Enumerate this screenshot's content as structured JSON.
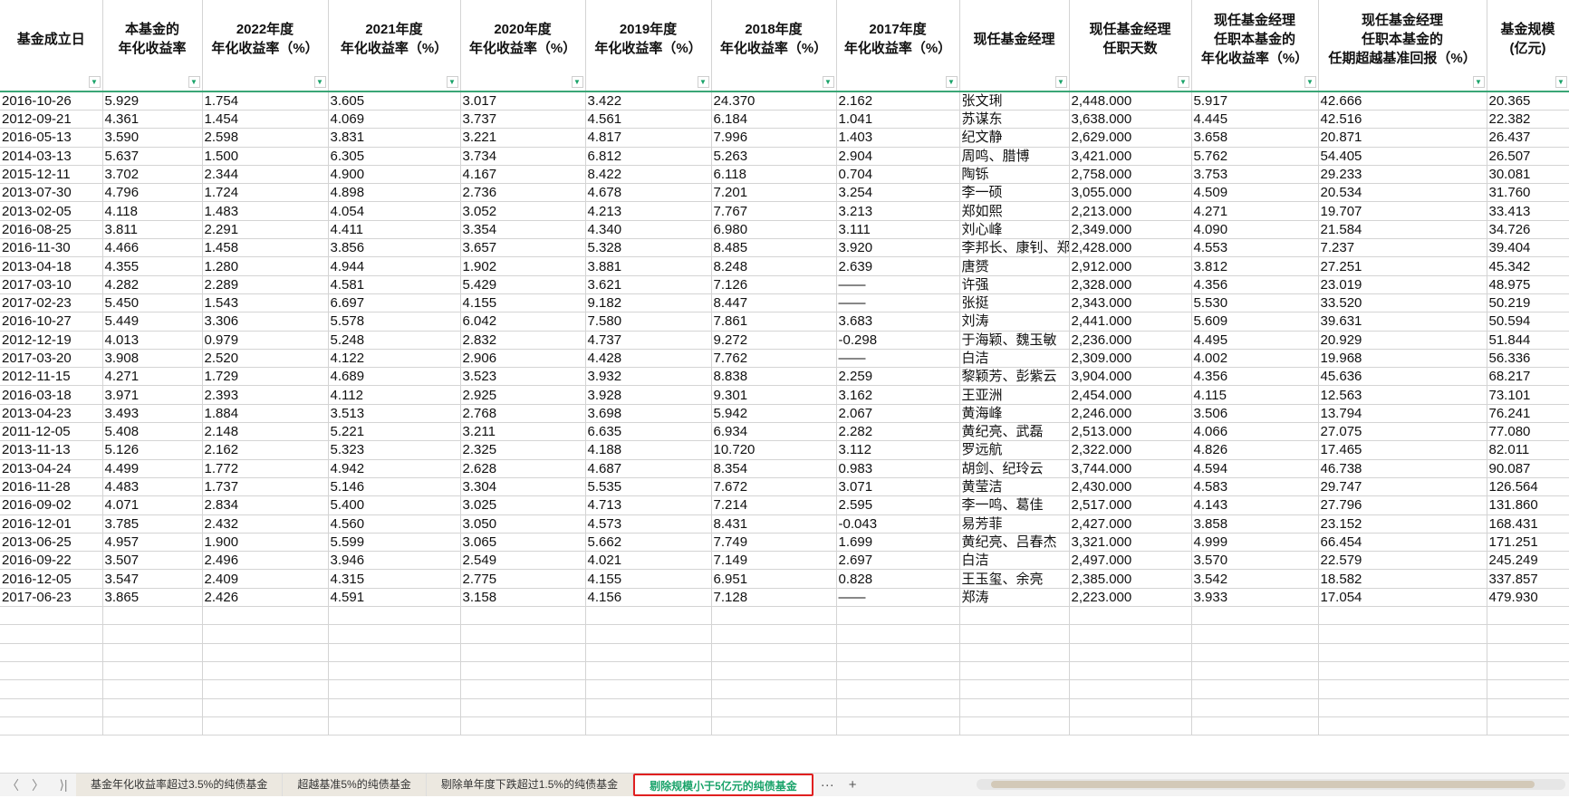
{
  "columns": [
    "基金成立日",
    "本基金的\n年化收益率",
    "2022年度\n年化收益率（%）",
    "2021年度\n年化收益率（%）",
    "2020年度\n年化收益率（%）",
    "2019年度\n年化收益率（%）",
    "2018年度\n年化收益率（%）",
    "2017年度\n年化收益率（%）",
    "现任基金经理",
    "现任基金经理\n任职天数",
    "现任基金经理\n任职本基金的\n年化收益率（%）",
    "现任基金经理\n任职本基金的\n任期超越基准回报（%）",
    "基金规模\n(亿元)"
  ],
  "rows": [
    [
      "2016-10-26",
      "5.929",
      "1.754",
      "3.605",
      "3.017",
      "3.422",
      "24.370",
      "2.162",
      "张文琍",
      "2,448.000",
      "5.917",
      "42.666",
      "20.365"
    ],
    [
      "2012-09-21",
      "4.361",
      "1.454",
      "4.069",
      "3.737",
      "4.561",
      "6.184",
      "1.041",
      "苏谋东",
      "3,638.000",
      "4.445",
      "42.516",
      "22.382"
    ],
    [
      "2016-05-13",
      "3.590",
      "2.598",
      "3.831",
      "3.221",
      "4.817",
      "7.996",
      "1.403",
      "纪文静",
      "2,629.000",
      "3.658",
      "20.871",
      "26.437"
    ],
    [
      "2014-03-13",
      "5.637",
      "1.500",
      "6.305",
      "3.734",
      "6.812",
      "5.263",
      "2.904",
      "周鸣、腊博",
      "3,421.000",
      "5.762",
      "54.405",
      "26.507"
    ],
    [
      "2015-12-11",
      "3.702",
      "2.344",
      "4.900",
      "4.167",
      "8.422",
      "6.118",
      "0.704",
      "陶铄",
      "2,758.000",
      "3.753",
      "29.233",
      "30.081"
    ],
    [
      "2013-07-30",
      "4.796",
      "1.724",
      "4.898",
      "2.736",
      "4.678",
      "7.201",
      "3.254",
      "李一硕",
      "3,055.000",
      "4.509",
      "20.534",
      "31.760"
    ],
    [
      "2013-02-05",
      "4.118",
      "1.483",
      "4.054",
      "3.052",
      "4.213",
      "7.767",
      "3.213",
      "郑如熙",
      "2,213.000",
      "4.271",
      "19.707",
      "33.413"
    ],
    [
      "2016-08-25",
      "3.811",
      "2.291",
      "4.411",
      "3.354",
      "4.340",
      "6.980",
      "3.111",
      "刘心峰",
      "2,349.000",
      "4.090",
      "21.584",
      "34.726"
    ],
    [
      "2016-11-30",
      "4.466",
      "1.458",
      "3.856",
      "3.657",
      "5.328",
      "8.485",
      "3.920",
      "李邦长、康钊、郑",
      "2,428.000",
      "4.553",
      "7.237",
      "39.404"
    ],
    [
      "2013-04-18",
      "4.355",
      "1.280",
      "4.944",
      "1.902",
      "3.881",
      "8.248",
      "2.639",
      "唐赟",
      "2,912.000",
      "3.812",
      "27.251",
      "45.342"
    ],
    [
      "2017-03-10",
      "4.282",
      "2.289",
      "4.581",
      "5.429",
      "3.621",
      "7.126",
      "——",
      "许强",
      "2,328.000",
      "4.356",
      "23.019",
      "48.975"
    ],
    [
      "2017-02-23",
      "5.450",
      "1.543",
      "6.697",
      "4.155",
      "9.182",
      "8.447",
      "——",
      "张挺",
      "2,343.000",
      "5.530",
      "33.520",
      "50.219"
    ],
    [
      "2016-10-27",
      "5.449",
      "3.306",
      "5.578",
      "6.042",
      "7.580",
      "7.861",
      "3.683",
      "刘涛",
      "2,441.000",
      "5.609",
      "39.631",
      "50.594"
    ],
    [
      "2012-12-19",
      "4.013",
      "0.979",
      "5.248",
      "2.832",
      "4.737",
      "9.272",
      "-0.298",
      "于海颖、魏玉敏",
      "2,236.000",
      "4.495",
      "20.929",
      "51.844"
    ],
    [
      "2017-03-20",
      "3.908",
      "2.520",
      "4.122",
      "2.906",
      "4.428",
      "7.762",
      "——",
      "白洁",
      "2,309.000",
      "4.002",
      "19.968",
      "56.336"
    ],
    [
      "2012-11-15",
      "4.271",
      "1.729",
      "4.689",
      "3.523",
      "3.932",
      "8.838",
      "2.259",
      "黎颖芳、彭紫云",
      "3,904.000",
      "4.356",
      "45.636",
      "68.217"
    ],
    [
      "2016-03-18",
      "3.971",
      "2.393",
      "4.112",
      "2.925",
      "3.928",
      "9.301",
      "3.162",
      "王亚洲",
      "2,454.000",
      "4.115",
      "12.563",
      "73.101"
    ],
    [
      "2013-04-23",
      "3.493",
      "1.884",
      "3.513",
      "2.768",
      "3.698",
      "5.942",
      "2.067",
      "黄海峰",
      "2,246.000",
      "3.506",
      "13.794",
      "76.241"
    ],
    [
      "2011-12-05",
      "5.408",
      "2.148",
      "5.221",
      "3.211",
      "6.635",
      "6.934",
      "2.282",
      "黄纪亮、武磊",
      "2,513.000",
      "4.066",
      "27.075",
      "77.080"
    ],
    [
      "2013-11-13",
      "5.126",
      "2.162",
      "5.323",
      "2.325",
      "4.188",
      "10.720",
      "3.112",
      "罗远航",
      "2,322.000",
      "4.826",
      "17.465",
      "82.011"
    ],
    [
      "2013-04-24",
      "4.499",
      "1.772",
      "4.942",
      "2.628",
      "4.687",
      "8.354",
      "0.983",
      "胡剑、纪玲云",
      "3,744.000",
      "4.594",
      "46.738",
      "90.087"
    ],
    [
      "2016-11-28",
      "4.483",
      "1.737",
      "5.146",
      "3.304",
      "5.535",
      "7.672",
      "3.071",
      "黄莹洁",
      "2,430.000",
      "4.583",
      "29.747",
      "126.564"
    ],
    [
      "2016-09-02",
      "4.071",
      "2.834",
      "5.400",
      "3.025",
      "4.713",
      "7.214",
      "2.595",
      "李一鸣、葛佳",
      "2,517.000",
      "4.143",
      "27.796",
      "131.860"
    ],
    [
      "2016-12-01",
      "3.785",
      "2.432",
      "4.560",
      "3.050",
      "4.573",
      "8.431",
      "-0.043",
      "易芳菲",
      "2,427.000",
      "3.858",
      "23.152",
      "168.431"
    ],
    [
      "2013-06-25",
      "4.957",
      "1.900",
      "5.599",
      "3.065",
      "5.662",
      "7.749",
      "1.699",
      "黄纪亮、吕春杰",
      "3,321.000",
      "4.999",
      "66.454",
      "171.251"
    ],
    [
      "2016-09-22",
      "3.507",
      "2.496",
      "3.946",
      "2.549",
      "4.021",
      "7.149",
      "2.697",
      "白洁",
      "2,497.000",
      "3.570",
      "22.579",
      "245.249"
    ],
    [
      "2016-12-05",
      "3.547",
      "2.409",
      "4.315",
      "2.775",
      "4.155",
      "6.951",
      "0.828",
      "王玉玺、余亮",
      "2,385.000",
      "3.542",
      "18.582",
      "337.857"
    ],
    [
      "2017-06-23",
      "3.865",
      "2.426",
      "4.591",
      "3.158",
      "4.156",
      "7.128",
      "——",
      "郑涛",
      "2,223.000",
      "3.933",
      "17.054",
      "479.930"
    ]
  ],
  "sheet_tabs": [
    "基金年化收益率超过3.5%的纯债基金",
    "超越基准5%的纯债基金",
    "剔除单年度下跌超过1.5%的纯债基金",
    "剔除规模小于5亿元的纯债基金"
  ],
  "active_tab": 3,
  "nav": {
    "prev": "〈",
    "next": "〉",
    "last": "⟩|",
    "more": "···",
    "add": "+"
  },
  "colors": {
    "accent": "#1aa36a",
    "active_border": "#e02020"
  }
}
